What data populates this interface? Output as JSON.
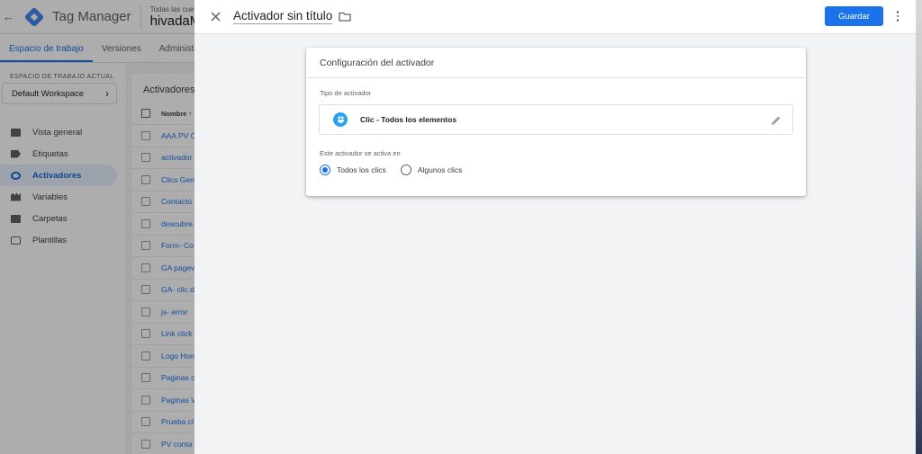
{
  "app": {
    "name": "Tag Manager",
    "account_small": "Todas las cuentas",
    "container_name": "hivadaMar"
  },
  "tabs": [
    "Espacio de trabajo",
    "Versiones",
    "Administrad"
  ],
  "workspace": {
    "label": "ESPACIO DE TRABAJO ACTUAL",
    "name": "Default Workspace"
  },
  "nav": [
    {
      "label": "Vista general",
      "icon": "overview-icon"
    },
    {
      "label": "Etiquetas",
      "icon": "tag-icon"
    },
    {
      "label": "Activadores",
      "icon": "trigger-icon",
      "active": true
    },
    {
      "label": "Variables",
      "icon": "variables-icon"
    },
    {
      "label": "Carpetas",
      "icon": "folder-icon"
    },
    {
      "label": "Plantillas",
      "icon": "template-icon"
    }
  ],
  "list": {
    "title": "Activadores",
    "column_name": "Nombre ↑",
    "rows": [
      "AAA PV C",
      "activador",
      "Clics Gen",
      "Contacto",
      "descubre",
      "Form- Co",
      "GA pagev",
      "GA- clic d",
      "js- error",
      "Link click",
      "Logo Hon",
      "Paginas c",
      "Paginas V",
      "Prueba cl",
      "PV conta"
    ]
  },
  "editor": {
    "title": "Activador sin título",
    "save_label": "Guardar",
    "card_title": "Configuración del activador",
    "type_label": "Tipo de activador",
    "type_name": "Clic - Todos los elementos",
    "fires_label": "Este activador se activa en",
    "options": [
      {
        "label": "Todos los clics",
        "selected": true
      },
      {
        "label": "Algunos clics",
        "selected": false
      }
    ]
  },
  "colors": {
    "accent": "#1a73e8",
    "trigger_icon_bg": "#29a3f0"
  }
}
